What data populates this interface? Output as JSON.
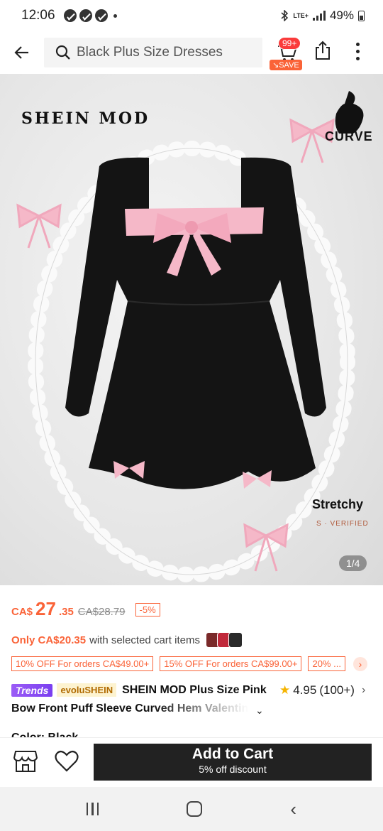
{
  "status_bar": {
    "time": "12:06",
    "network": "LTE+",
    "battery": "49%"
  },
  "header": {
    "search_text": "Black Plus Size Dresses",
    "cart_count": "99+",
    "save_label": "SAVE"
  },
  "image": {
    "brand_logo": "SHEIN MOD",
    "curve_logo": "CURVE",
    "stretchy_label": "Stretchy",
    "verified_label": "S · VERIFIED",
    "counter": "1/4"
  },
  "price": {
    "currency": "CA$",
    "main": "27",
    "cents": ".35",
    "original": "CA$28.79",
    "discount": "-5%"
  },
  "cart_offer": {
    "highlight": "Only CA$20.35",
    "rest": "with selected cart items"
  },
  "promos": [
    "10% OFF For orders CA$49.00+",
    "15% OFF For orders CA$99.00+",
    "20% ..."
  ],
  "title": {
    "trends_tag": "Trends",
    "evolu_tag": "evoluSHEIN",
    "line1": "SHEIN MOD Plus Size Pink",
    "line2": "Bow Front Puff Sleeve Curved Hem Valentin",
    "rating": "4.95",
    "reviews": "(100+)"
  },
  "color_peek": "Color: Black",
  "action_bar": {
    "add_to_cart": "Add to Cart",
    "discount_note": "5% off discount"
  },
  "colors": {
    "accent": "#fa6338",
    "dark": "#222222",
    "pink_bow": "#f5b8c8"
  }
}
